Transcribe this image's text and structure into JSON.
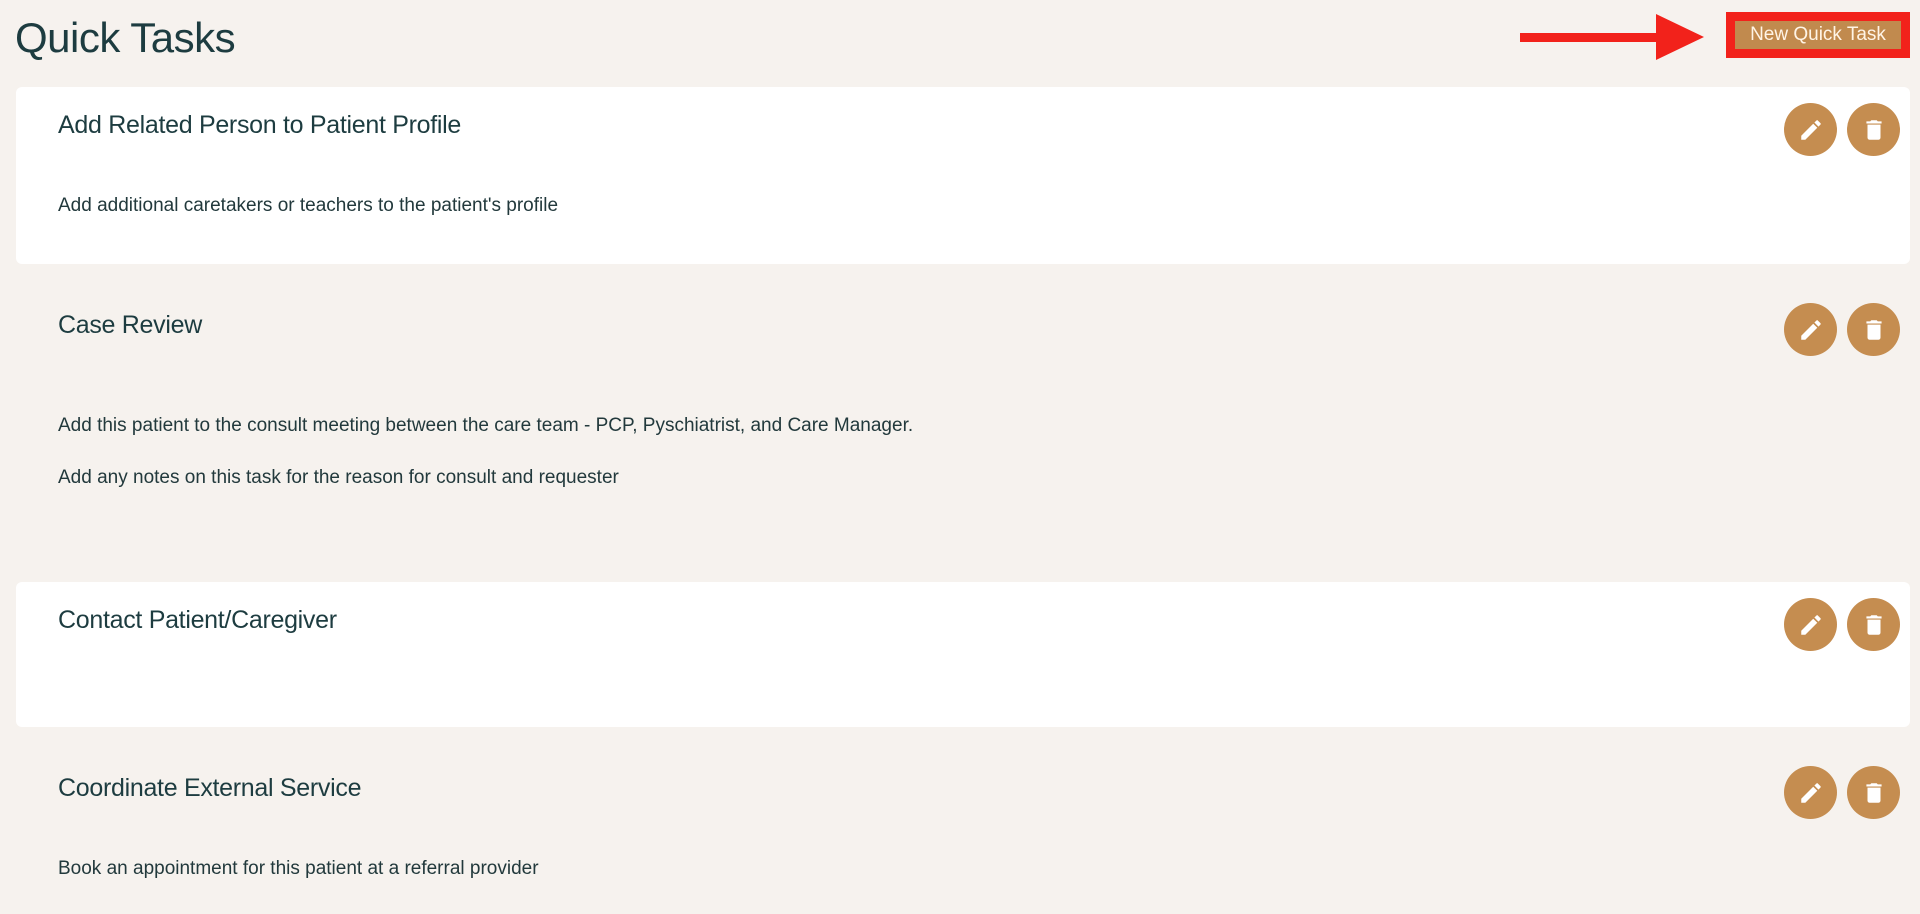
{
  "page": {
    "title": "Quick Tasks"
  },
  "toolbar": {
    "new_label": "New Quick Task"
  },
  "colors": {
    "accent": "#c58d50",
    "highlight": "#f2221b",
    "background": "#f6f2ee",
    "text": "#1d3c40"
  },
  "icons": {
    "edit": "pencil-icon",
    "delete": "trash-icon",
    "annotation": "red-arrow"
  },
  "tasks": [
    {
      "title": "Add Related Person to Patient Profile",
      "description": [
        "Add additional caretakers or teachers to the patient's profile"
      ]
    },
    {
      "title": "Case Review",
      "description": [
        "Add this patient to the consult meeting between the care team - PCP, Pyschiatrist, and Care Manager.",
        "Add any notes on this task for the reason for consult and requester"
      ]
    },
    {
      "title": "Contact Patient/Caregiver",
      "description": []
    },
    {
      "title": "Coordinate External Service",
      "description": [
        "Book an appointment for this patient at a referral provider"
      ]
    }
  ]
}
